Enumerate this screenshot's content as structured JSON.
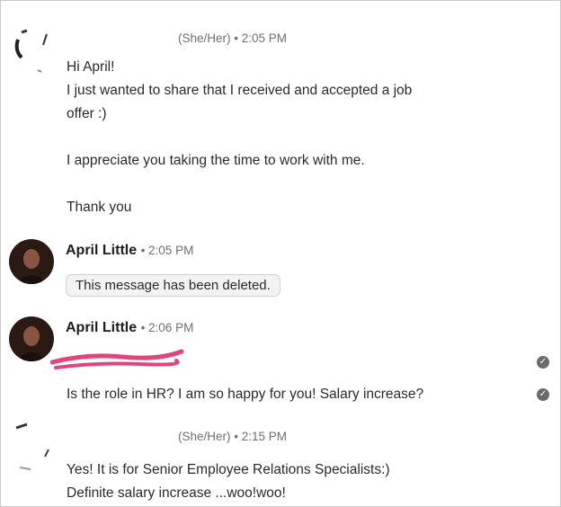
{
  "messages": [
    {
      "pronouns_time": "(She/Her) • 2:05 PM",
      "lines": [
        "Hi April!",
        "I just wanted to share that I received and accepted a job",
        "offer :)",
        "",
        "I appreciate you taking the time to work with me.",
        "",
        "Thank you"
      ]
    },
    {
      "sender": "April Little",
      "time": "• 2:05 PM",
      "deleted_text": "This message has been deleted."
    },
    {
      "sender": "April Little",
      "time": "• 2:06 PM",
      "line2": "Is the role in HR? I am so happy for you! Salary increase?"
    },
    {
      "pronouns_time": "(She/Her) • 2:15 PM",
      "lines": [
        "Yes! It is for Senior Employee Relations Specialists:)",
        "Definite salary increase ...woo!woo!"
      ]
    }
  ],
  "colors": {
    "redaction": "#e0457b",
    "deleted_bg": "#f3f3f3",
    "read_check": "#6b6b6b"
  },
  "icons": {
    "read_receipt": "check-circle-icon"
  }
}
